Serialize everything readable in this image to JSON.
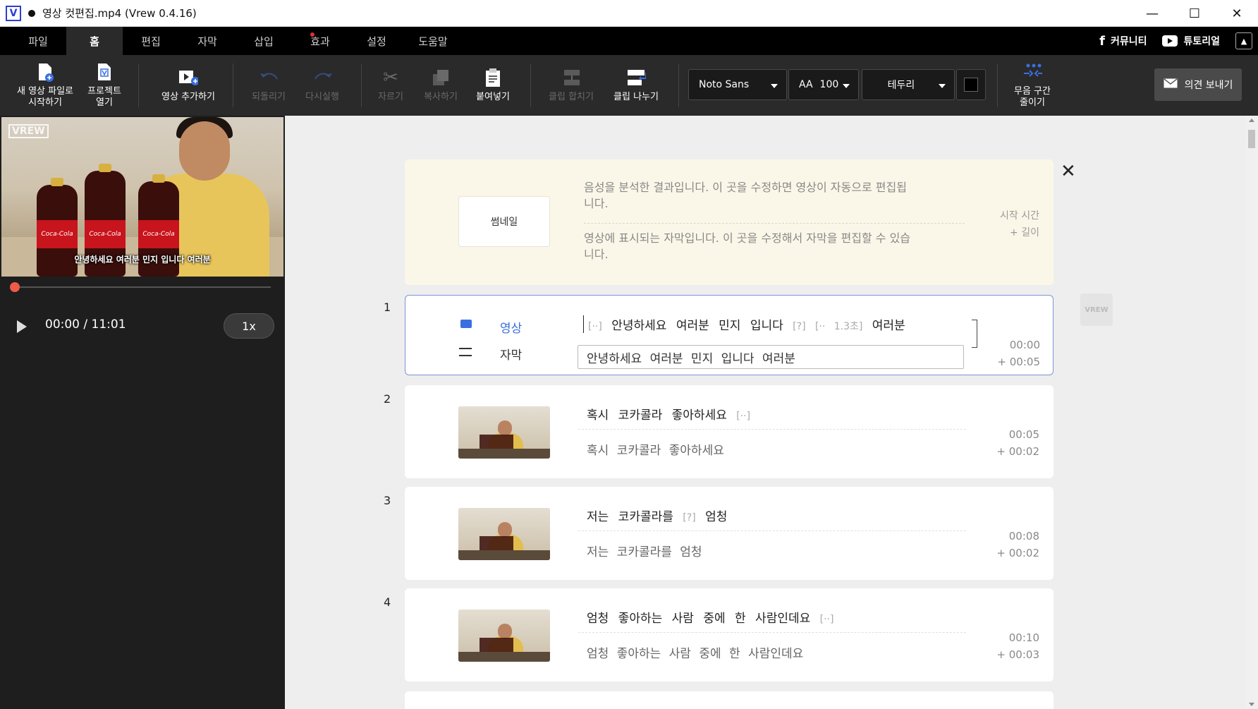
{
  "window": {
    "title": "영상 컷편집.mp4 (Vrew 0.4.16)",
    "logo": "V"
  },
  "menu": {
    "items": [
      "파일",
      "홈",
      "편집",
      "자막",
      "삽입",
      "효과",
      "설정",
      "도움말"
    ],
    "active": "홈",
    "community": "커뮤니티",
    "tutorial": "튜토리얼"
  },
  "toolbar": {
    "new_video_1": "새 영상 파일로",
    "new_video_2": "시작하기",
    "open_project_1": "프로젝트",
    "open_project_2": "열기",
    "add_video": "영상 추가하기",
    "undo": "되돌리기",
    "redo": "다시실행",
    "cut": "자르기",
    "copy": "복사하기",
    "paste": "붙여넣기",
    "merge_clips": "클립 합치기",
    "split_clip": "클립 나누기",
    "font_name": "Noto Sans",
    "font_size_prefix": "AA",
    "font_size": "100",
    "outline": "테두리",
    "outline_color": "#000000",
    "silence_1": "무음 구간",
    "silence_2": "줄이기",
    "feedback": "의견 보내기"
  },
  "player": {
    "watermark": "VREW",
    "caption": "안녕하세요 여러분 민지 입니다 여러분",
    "time": "00:00 / 11:01",
    "speed": "1x",
    "progress": 0.0
  },
  "header_card": {
    "thumbnail_label": "썸네일",
    "voice_desc_1": "음성을 분석한 결과입니다. 이 곳을 수정하면 영상이 자동으로 편집됩",
    "voice_desc_2": "니다.",
    "subtitle_desc_1": "영상에 표시되는 자막입니다. 이 곳을 수정해서 자막을 편집할 수 있습",
    "subtitle_desc_2": "니다.",
    "start_time_label": "시작 시간",
    "length_label": "+ 길이"
  },
  "clips": [
    {
      "num": "1",
      "video_label": "영상",
      "subtitle_label": "자막",
      "ph1": "[··]",
      "t1": "안녕하세요 여러분 민지 입니다",
      "ph2": "[?]",
      "ph3": "[·· 1.3초]",
      "t2": "여러분",
      "subtitle": "안녕하세요 여러분 민지 입니다 여러분",
      "start": "00:00",
      "length": "+ 00:05"
    },
    {
      "num": "2",
      "t1": "혹시 코카콜라 좋아하세요",
      "ph1": "[··]",
      "subtitle": "혹시 코카콜라 좋아하세요",
      "start": "00:05",
      "length": "+ 00:02"
    },
    {
      "num": "3",
      "t1": "저는 코카콜라를",
      "ph1": "[?]",
      "t2": "엄청",
      "subtitle": "저는 코카콜라를 엄청",
      "start": "00:08",
      "length": "+ 00:02"
    },
    {
      "num": "4",
      "t1": "엄청 좋아하는 사람 중에 한 사람인데요",
      "ph1": "[··]",
      "subtitle": "엄청 좋아하는 사람 중에 한 사람인데요",
      "start": "00:10",
      "length": "+ 00:03"
    }
  ]
}
